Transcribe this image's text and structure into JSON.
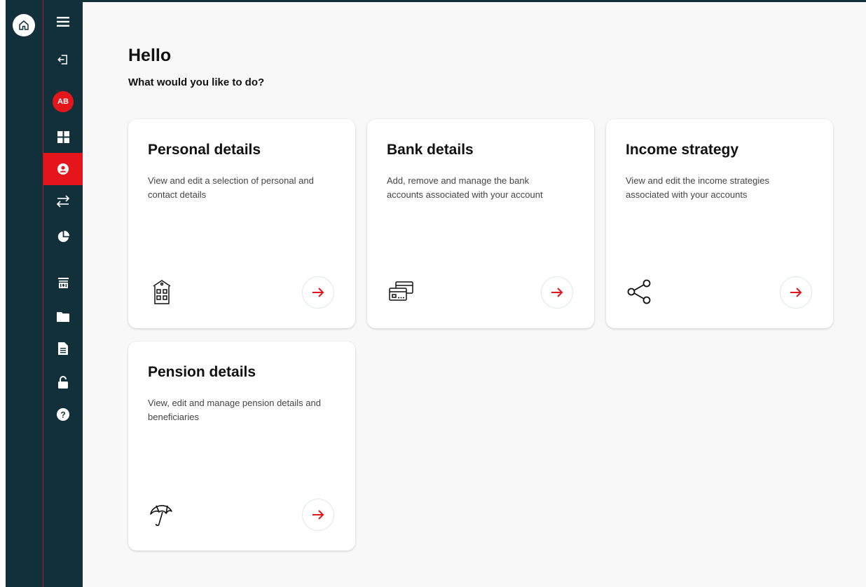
{
  "profile": {
    "initials": "AB"
  },
  "header": {
    "greeting": "Hello",
    "subtitle": "What would you like to do?"
  },
  "sidebar": {
    "items": [
      {
        "icon": "menu-icon"
      },
      {
        "icon": "logout-icon"
      },
      {
        "icon": "avatar"
      },
      {
        "icon": "dashboard-icon"
      },
      {
        "icon": "profile-icon",
        "active": true
      },
      {
        "icon": "transfer-icon"
      },
      {
        "icon": "pie-chart-icon"
      },
      {
        "icon": "bank-icon"
      },
      {
        "icon": "folder-icon"
      },
      {
        "icon": "document-icon"
      },
      {
        "icon": "unlock-icon"
      },
      {
        "icon": "help-icon"
      }
    ]
  },
  "cards": [
    {
      "title": "Personal details",
      "description": "View and edit a selection of personal and contact details",
      "icon": "building-icon"
    },
    {
      "title": "Bank details",
      "description": "Add, remove and manage the bank accounts associated with your account",
      "icon": "bank-card-icon"
    },
    {
      "title": "Income strategy",
      "description": "View and edit the income strategies associated with your accounts",
      "icon": "share-icon"
    },
    {
      "title": "Pension details",
      "description": "View, edit and manage pension details and beneficiaries",
      "icon": "umbrella-icon"
    }
  ],
  "colors": {
    "sidebar_bg": "#12303a",
    "accent_red": "#e4161b",
    "page_bg": "#f8f8f8"
  }
}
